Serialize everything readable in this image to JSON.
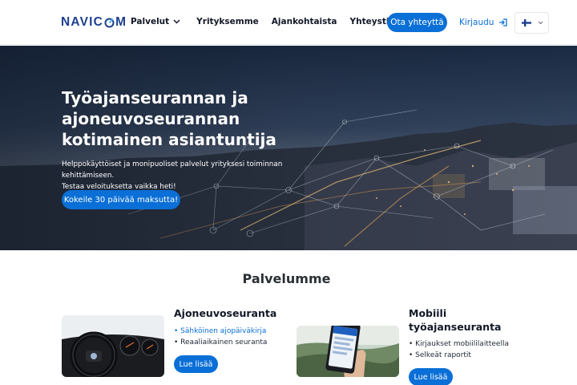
{
  "header": {
    "logo_text": "NAVICOM",
    "nav": [
      {
        "label": "Palvelut",
        "has_dropdown": true
      },
      {
        "label": "Yrityksemme"
      },
      {
        "label": "Ajankohtaista"
      },
      {
        "label": "Yhteystiedot"
      }
    ],
    "contact_button": "Ota yhteyttä",
    "login_link": "Kirjaudu",
    "language": {
      "selected": "fi",
      "icon": "finland-flag-icon"
    }
  },
  "hero": {
    "title": "Työajanseurannan ja ajoneuvoseurannan kotimainen asiantuntija",
    "text_line1": "Helppokäyttöiset ja monipuoliset palvelut yrityksesi toiminnan kehittämiseen.",
    "text_line2": "Testaa veloituksetta vaikka heti!",
    "cta": "Kokeile 30 päivää maksutta!"
  },
  "services": {
    "title": "Palvelumme",
    "cards": [
      {
        "title": "Ajoneuvoseuranta",
        "items": [
          "Sähköinen ajopäiväkirja",
          "Reaaliaikainen seuranta"
        ],
        "button": "Lue lisää",
        "image": "car-dashboard-image"
      },
      {
        "title": "Mobiili työajanseuranta",
        "items": [
          "Kirjaukset mobiililaitteella",
          "Selkeät raportit"
        ],
        "button": "Lue lisää",
        "image": "smartphone-app-image"
      }
    ]
  },
  "colors": {
    "primary": "#0a6fd6",
    "brand": "#1d3f8f",
    "text": "#111827"
  }
}
